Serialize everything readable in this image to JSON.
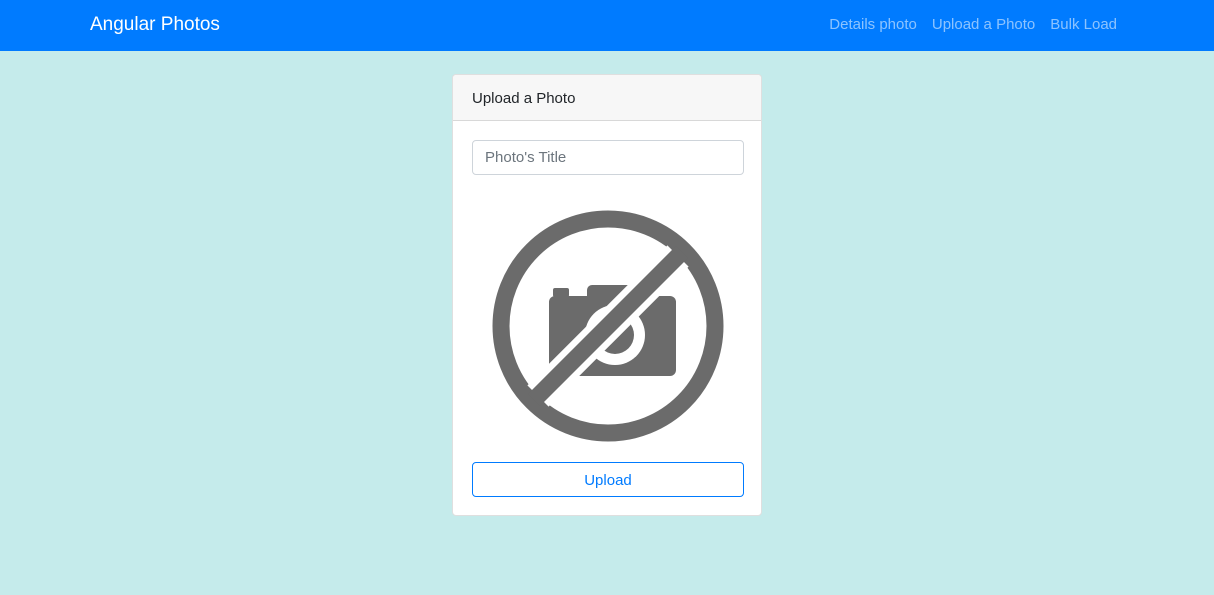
{
  "navbar": {
    "brand": "Angular Photos",
    "links": [
      {
        "label": "Details photo"
      },
      {
        "label": "Upload a Photo"
      },
      {
        "label": "Bulk Load"
      }
    ],
    "color": "#007bff"
  },
  "card": {
    "header": "Upload a Photo",
    "title_input": {
      "value": "",
      "placeholder": "Photo's Title"
    },
    "preview_icon": "no-photo-icon",
    "upload_label": "Upload"
  },
  "colors": {
    "page_background": "#c5ebeb",
    "accent": "#007bff",
    "icon": "#6b6b6b"
  }
}
